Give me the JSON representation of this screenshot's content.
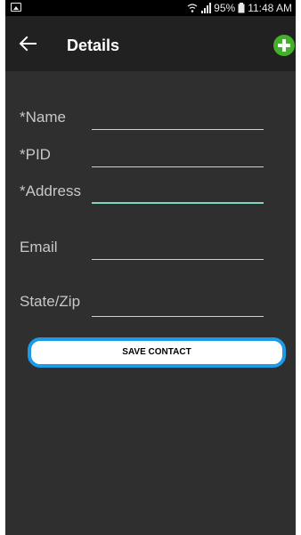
{
  "status_bar": {
    "battery_percent": "95%",
    "time": "11:48 AM"
  },
  "header": {
    "title": "Details",
    "back_icon": "arrow-left-icon",
    "add_icon": "plus-circle-icon",
    "add_color": "#43b02a"
  },
  "form": {
    "fields": [
      {
        "label": "*Name",
        "value": ""
      },
      {
        "label": "*PID",
        "value": ""
      },
      {
        "label": "*Address",
        "value": ""
      },
      {
        "label": "Email",
        "value": ""
      },
      {
        "label": "State/Zip",
        "value": ""
      }
    ],
    "focus_color": "#7ed6c2"
  },
  "save_button": {
    "label": "SAVE CONTACT",
    "border_color": "#1e9be6"
  }
}
